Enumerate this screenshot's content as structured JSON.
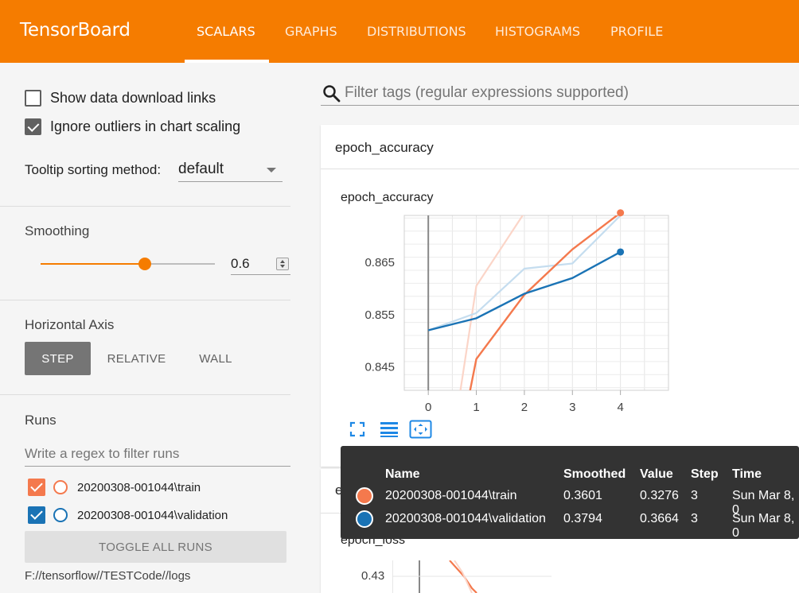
{
  "app": {
    "brand": "TensorBoard",
    "tabs": [
      {
        "label": "SCALARS",
        "active": true
      },
      {
        "label": "GRAPHS"
      },
      {
        "label": "DISTRIBUTIONS"
      },
      {
        "label": "HISTOGRAMS"
      },
      {
        "label": "PROFILE"
      }
    ],
    "header_color": "#f57c00"
  },
  "sidebar": {
    "show_download_links": {
      "label": "Show data download links",
      "checked": false
    },
    "ignore_outliers": {
      "label": "Ignore outliers in chart scaling",
      "checked": true
    },
    "tooltip_sorting": {
      "label": "Tooltip sorting method:",
      "value": "default"
    },
    "smoothing": {
      "title": "Smoothing",
      "value": "0.6",
      "fraction": 0.6
    },
    "horizontal_axis": {
      "title": "Horizontal Axis",
      "options": [
        {
          "label": "STEP",
          "active": true
        },
        {
          "label": "RELATIVE"
        },
        {
          "label": "WALL"
        }
      ]
    },
    "runs": {
      "title": "Runs",
      "filter_placeholder": "Write a regex to filter runs",
      "items": [
        {
          "label": "20200308-001044\\train",
          "color": "#f4794d",
          "checkbox_color": "#f4794d"
        },
        {
          "label": "20200308-001044\\validation",
          "color": "#1a73b5",
          "checkbox_color": "#1a73b5"
        }
      ],
      "toggle_label": "TOGGLE ALL RUNS",
      "logdir": "F://tensorflow//TESTCode//logs"
    }
  },
  "main": {
    "filter_placeholder": "Filter tags (regular expressions supported)",
    "cards": [
      {
        "title": "epoch_accuracy"
      },
      {
        "title": "epoch_loss"
      }
    ]
  },
  "chart_data": [
    {
      "type": "line",
      "title": "epoch_accuracy",
      "x": [
        0,
        1,
        2,
        3,
        4
      ],
      "xlim": [
        -0.5,
        5
      ],
      "ylim": [
        0.8405,
        0.874
      ],
      "yticks": [
        "0.845",
        "0.855",
        "0.865"
      ],
      "xticks": [
        "0",
        "1",
        "2",
        "3",
        "4"
      ],
      "grid": true,
      "series": [
        {
          "name": "20200308-001044\\train",
          "color": "#f4794d",
          "raw_color": "#fbd5c8",
          "values": [
            0.8,
            0.8465,
            0.8588,
            0.8675,
            0.8745
          ],
          "raw_values": [
            0.8,
            0.8605,
            0.8745,
            0.886,
            0.9
          ]
        },
        {
          "name": "20200308-001044\\validation",
          "color": "#1a73b5",
          "raw_color": "#c5ddef",
          "values": [
            0.852,
            0.8543,
            0.859,
            0.862,
            0.867
          ],
          "raw_values": [
            0.852,
            0.8553,
            0.8638,
            0.8648,
            0.874
          ]
        }
      ]
    }
  ],
  "tooltip": {
    "headers": [
      "Name",
      "Smoothed",
      "Value",
      "Step",
      "Time"
    ],
    "rows": [
      {
        "name": "20200308-001044\\train",
        "smoothed": "0.3601",
        "value": "0.3276",
        "step": "3",
        "time": "Sun Mar 8, 0",
        "color": "#f4794d"
      },
      {
        "name": "20200308-001044\\validation",
        "smoothed": "0.3794",
        "value": "0.3664",
        "step": "3",
        "time": "Sun Mar 8, 0",
        "color": "#1a73b5"
      }
    ]
  },
  "loss_chart": {
    "ytick": "0.43"
  },
  "watermark": "https://blog.csdn.net/qq_40041064"
}
